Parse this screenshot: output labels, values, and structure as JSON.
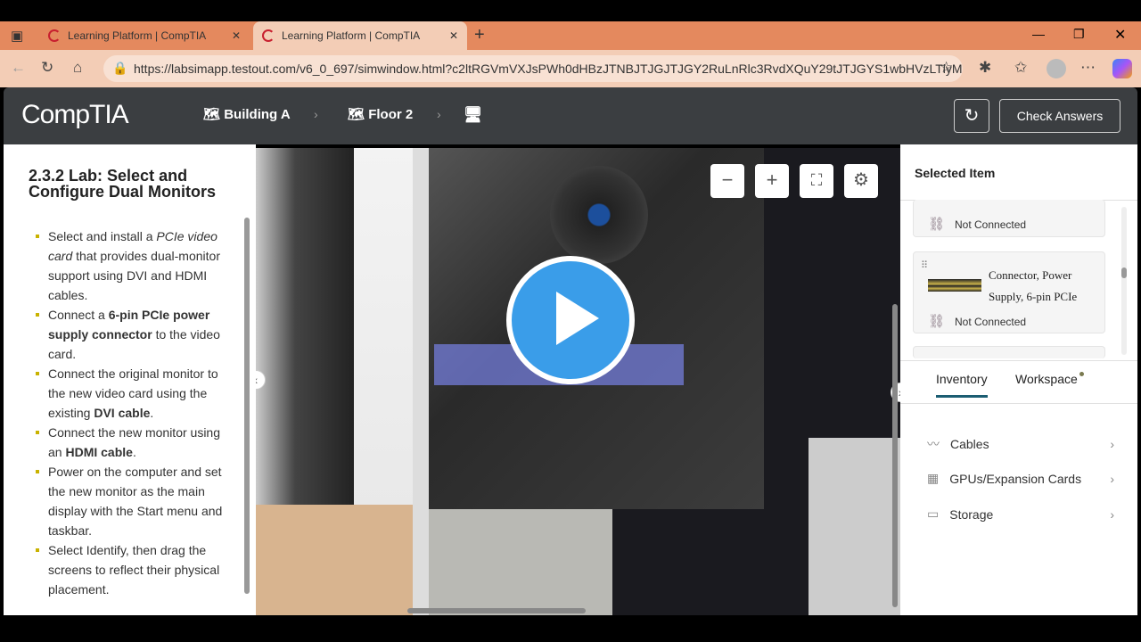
{
  "browser": {
    "tabs": [
      {
        "title": "Learning Platform | CompTIA"
      },
      {
        "title": "Learning Platform | CompTIA"
      }
    ],
    "url": "https://labsimapp.testout.com/v6_0_697/simwindow.html?c2ltRGVmVXJsPWh0dHBzJTNBJTJGJTJGY2RuLnRlc3RvdXQuY29tJTJGYS1wbHVzLTlyM..."
  },
  "header": {
    "logo": "CompTIA",
    "breadcrumb": [
      "Building A",
      "Floor 2"
    ],
    "check_answers": "Check Answers"
  },
  "lab": {
    "title": "2.3.2 Lab: Select and Configure Dual Monitors",
    "tasks": [
      [
        {
          "t": "Select and install a "
        },
        {
          "t": "PCIe video card",
          "i": 1
        },
        {
          "t": " that provides dual-monitor support using DVI and HDMI cables."
        }
      ],
      [
        {
          "t": "Connect a "
        },
        {
          "t": "6-pin PCIe power supply connector",
          "b": 1
        },
        {
          "t": " to the video card."
        }
      ],
      [
        {
          "t": "Connect the original monitor to the new video card using the existing "
        },
        {
          "t": "DVI cable",
          "b": 1
        },
        {
          "t": "."
        }
      ],
      [
        {
          "t": "Connect the new monitor using an "
        },
        {
          "t": "HDMI cable",
          "b": 1
        },
        {
          "t": "."
        }
      ],
      [
        {
          "t": "Power on the computer and set the new monitor as the main display with the Start menu and taskbar."
        }
      ],
      [
        {
          "t": "Select Identify, then drag the screens to reflect their physical placement."
        }
      ]
    ]
  },
  "panel": {
    "selected_title": "Selected Item",
    "items": [
      {
        "status": "Not Connected"
      },
      {
        "name": "Connector, Power Supply, 6-pin PCIe",
        "status": "Not Connected"
      }
    ],
    "tabs": [
      "Inventory",
      "Workspace"
    ],
    "active_tab": "Inventory",
    "categories": [
      {
        "label": "Cables",
        "icon": "cable-icon"
      },
      {
        "label": "GPUs/Expansion Cards",
        "icon": "gpu-icon"
      },
      {
        "label": "Storage",
        "icon": "storage-icon"
      }
    ]
  },
  "colors": {
    "accent": "#3a9de9",
    "header": "#3b3e41",
    "tab_underline": "#1b5d72"
  }
}
